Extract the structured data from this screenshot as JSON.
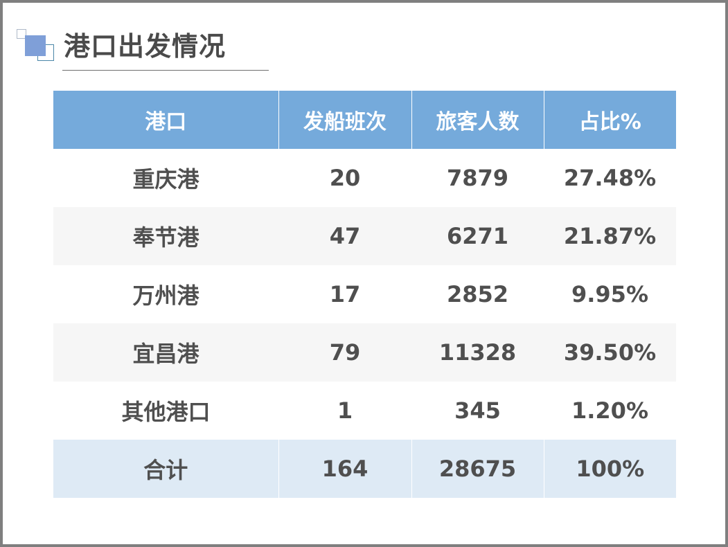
{
  "title": "港口出发情况",
  "table": {
    "headers": [
      "港口",
      "发船班次",
      "旅客人数",
      "占比%"
    ],
    "rows": [
      [
        "重庆港",
        "20",
        "7879",
        "27.48%"
      ],
      [
        "奉节港",
        "47",
        "6271",
        "21.87%"
      ],
      [
        "万州港",
        "17",
        "2852",
        "9.95%"
      ],
      [
        "宜昌港",
        "79",
        "11328",
        "39.50%"
      ],
      [
        "其他港口",
        "1",
        "345",
        "1.20%"
      ]
    ],
    "total": [
      "合计",
      "164",
      "28675",
      "100%"
    ]
  },
  "colors": {
    "header_bg": "#75aadb",
    "header_text": "#ffffff",
    "body_text": "#4f4f4f",
    "stripe_bg": "#f6f6f6",
    "total_bg": "#deeaf5",
    "accent_square": "#7f9fd8",
    "frame_border": "#7f7f7f"
  }
}
